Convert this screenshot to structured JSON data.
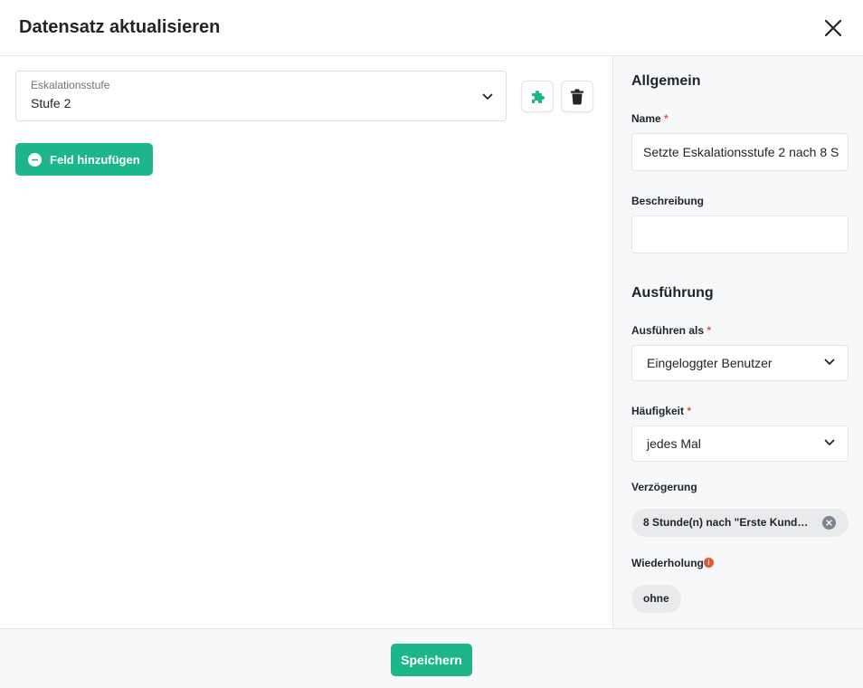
{
  "dialog": {
    "title": "Datensatz aktualisieren"
  },
  "main": {
    "field": {
      "label": "Eskalationsstufe",
      "value": "Stufe 2"
    },
    "add_field_label": "Feld hinzufügen"
  },
  "side": {
    "general_title": "Allgemein",
    "name_label": "Name",
    "name_required": "*",
    "name_value": "Setzte Eskalationsstufe 2 nach 8 S",
    "description_label": "Beschreibung",
    "description_value": "",
    "execution_title": "Ausführung",
    "run_as_label": "Ausführen als",
    "run_as_required": "*",
    "run_as_value": "Eingeloggter Benutzer",
    "frequency_label": "Häufigkeit",
    "frequency_required": "*",
    "frequency_value": "jedes Mal",
    "delay_label": "Verzögerung",
    "delay_value": "8 Stunde(n) nach \"Erste Kunden...",
    "repeat_label": "Wiederholung",
    "repeat_value": "ohne"
  },
  "footer": {
    "save_label": "Speichern"
  },
  "colors": {
    "accent": "#1db58a",
    "required": "#e4572e"
  }
}
